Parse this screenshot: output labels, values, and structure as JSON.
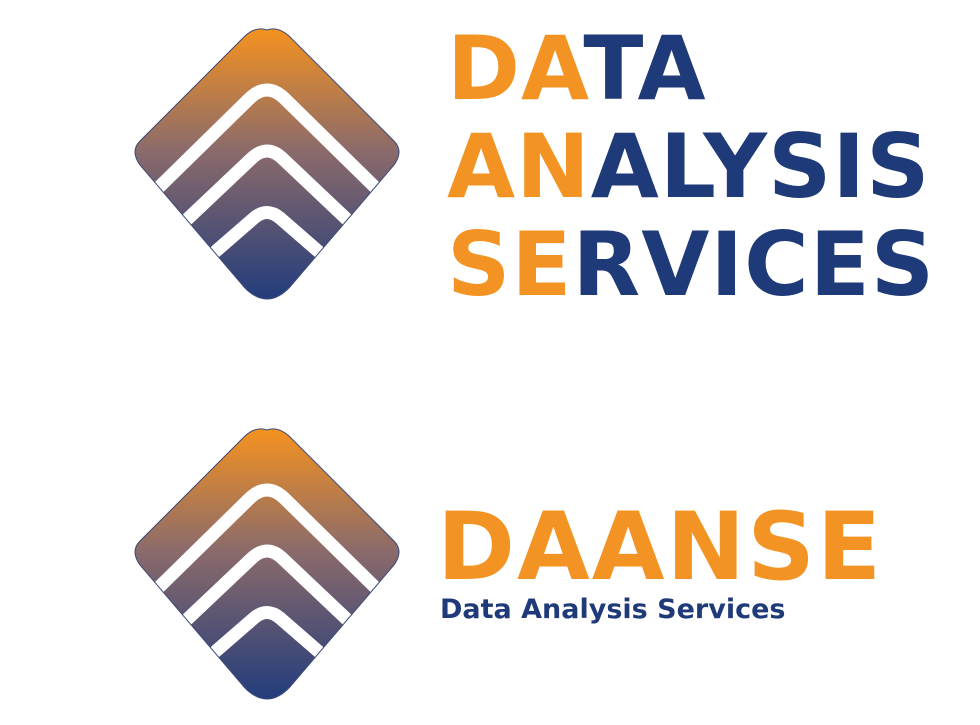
{
  "brand": {
    "colors": {
      "orange": "#f39323",
      "navy": "#1f3a78"
    },
    "mark_icon": "layered-diamond-icon",
    "stacked_lines": [
      {
        "accent": "DA",
        "rest": "TA"
      },
      {
        "accent": "AN",
        "rest": "ALYSIS"
      },
      {
        "accent": "SE",
        "rest": "RVICES"
      }
    ],
    "acronym": "DAANSE",
    "tagline": "Data Analysis Services"
  }
}
